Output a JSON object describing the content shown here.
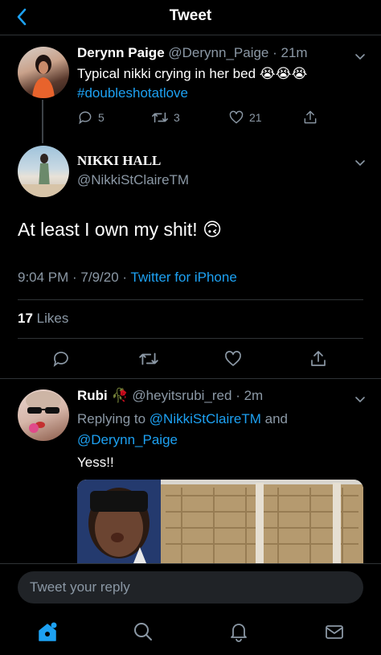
{
  "header": {
    "title": "Tweet"
  },
  "parent_tweet": {
    "name": "Derynn Paige",
    "handle": "@Derynn_Paige",
    "time": "21m",
    "text": "Typical nikki crying in her bed",
    "emoji": "😭😭😭",
    "hashtag": "#doubleshotatlove",
    "replies": "5",
    "retweets": "3",
    "likes": "21"
  },
  "main_tweet": {
    "name": "NIKKI HALL",
    "handle": "@NikkiStClaireTM",
    "text": "At least I own my shit!",
    "emoji": "🙃",
    "time": "9:04 PM",
    "date": "7/9/20",
    "source": "Twitter for iPhone",
    "likes_count": "17",
    "likes_label": "Likes"
  },
  "reply_tweet": {
    "name": "Rubi",
    "name_emoji": "🥀",
    "handle": "@heyitsrubi_red",
    "time": "2m",
    "replying_to_label": "Replying to",
    "replying_to_user1": "@NikkiStClaireTM",
    "replying_and": "and",
    "replying_to_user2": "@Derynn_Paige",
    "text": "Yess!!"
  },
  "reply_bar": {
    "placeholder": "Tweet your reply"
  },
  "tabs": [
    "home",
    "search",
    "notifications",
    "messages"
  ],
  "colors": {
    "accent": "#1da1f2",
    "muted": "#8b98a5",
    "background": "#000000",
    "divider": "#2f3336"
  }
}
